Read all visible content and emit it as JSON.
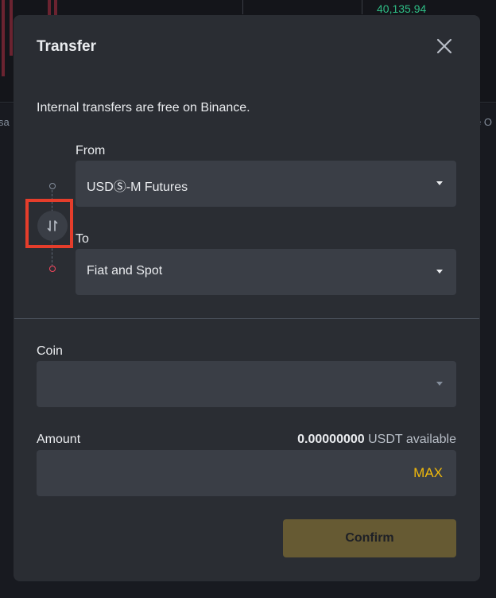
{
  "background": {
    "price": "40,135.94",
    "left_partial_text": "sa",
    "right_partial_text": "e O"
  },
  "modal": {
    "title": "Transfer",
    "info": "Internal transfers are free on Binance.",
    "from": {
      "label": "From",
      "value": "USDⓈ-M Futures"
    },
    "to": {
      "label": "To",
      "value": "Fiat and Spot"
    },
    "coin": {
      "label": "Coin",
      "value": ""
    },
    "amount": {
      "label": "Amount",
      "available_value": "0.00000000",
      "available_unit": "USDT available",
      "value": "",
      "max_label": "MAX"
    },
    "confirm_label": "Confirm"
  },
  "icons": {
    "close": "close-icon",
    "swap": "swap-arrows-icon",
    "caret": "chevron-down-icon"
  },
  "colors": {
    "accent": "#f0b90b",
    "highlight": "#e53d2b",
    "modal_bg": "#2a2d33",
    "field_bg": "#3a3e46",
    "confirm_bg_disabled": "#665a33"
  }
}
